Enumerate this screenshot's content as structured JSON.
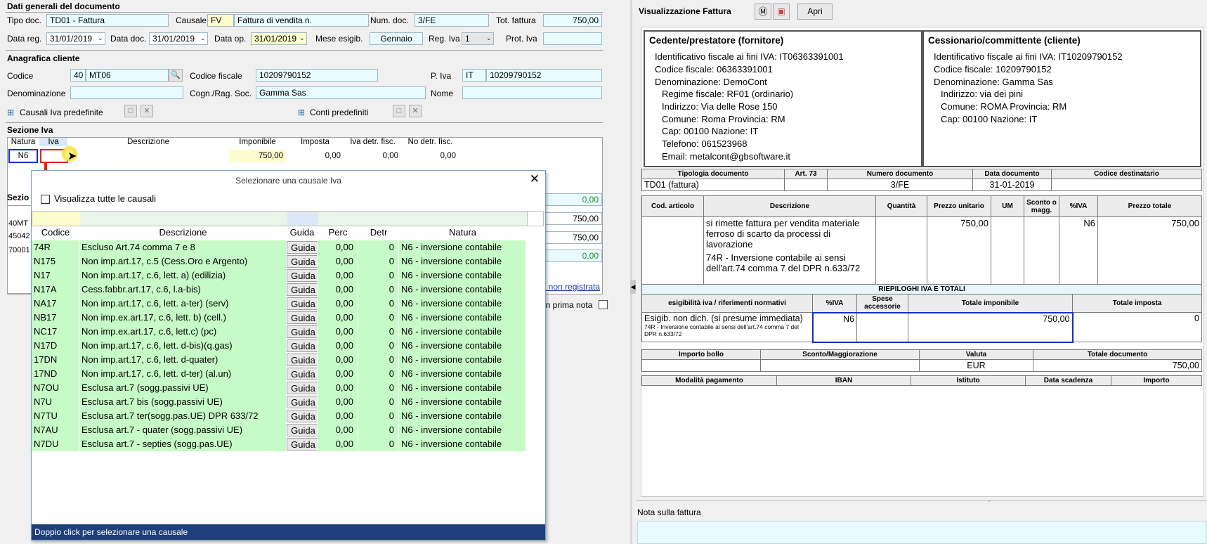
{
  "left": {
    "section_general": "Dati generali del documento",
    "tipo_doc_label": "Tipo doc.",
    "tipo_doc_value": "TD01 - Fattura",
    "causale_label": "Causale",
    "causale_code": "FV",
    "causale_desc": "Fattura di vendita n.",
    "num_doc_label": "Num. doc.",
    "num_doc_value": "3/FE",
    "tot_fattura_label": "Tot. fattura",
    "tot_fattura_value": "750,00",
    "data_reg_label": "Data reg.",
    "data_reg_value": "31/01/2019",
    "data_doc_label": "Data doc.",
    "data_doc_value": "31/01/2019",
    "data_op_label": "Data op.",
    "data_op_value": "31/01/2019",
    "mese_esigib_label": "Mese esigib.",
    "mese_esigib_value": "Gennaio",
    "reg_iva_label": "Reg. Iva",
    "reg_iva_value": "1",
    "prot_iva_label": "Prot. Iva",
    "prot_iva_value": "",
    "section_cliente": "Anagrafica cliente",
    "codice_label": "Codice",
    "codice_num": "40",
    "codice_value": "MT06",
    "codice_fiscale_label": "Codice fiscale",
    "codice_fiscale_value": "10209790152",
    "piva_label": "P. Iva",
    "piva_country": "IT",
    "piva_value": "10209790152",
    "denominazione_label": "Denominazione",
    "cogn_label": "Cogn./Rag. Soc.",
    "cogn_value": "Gamma Sas",
    "nome_label": "Nome",
    "causali_predef": "Causali Iva predefinite",
    "conti_predef": "Conti predefiniti",
    "section_iva": "Sezione Iva",
    "iva_cols": [
      "Natura",
      "Iva",
      "Descrizione",
      "Imponibile",
      "Imposta",
      "Iva detr. fisc.",
      "No detr. fisc."
    ],
    "iva_row": {
      "natura": "N6",
      "iva": "",
      "descrizione": "",
      "imponibile": "750,00",
      "imposta": "0,00",
      "detr": "0,00",
      "nodetr": "0,00"
    },
    "section_other_partial": "Sezio",
    "partial_rows": [
      "40MT",
      "45042",
      "70001"
    ],
    "right_vals": [
      "0,00",
      "750,00",
      "750,00",
      "0,00"
    ],
    "link_non_registrata": "t non registrata",
    "prima_nota": "in prima nota"
  },
  "popup": {
    "title": "Selezionare una causale Iva",
    "checkbox_label": "Visualizza tutte le causali",
    "columns": [
      "Codice",
      "Descrizione",
      "Guida",
      "Perc",
      "Detr",
      "Natura"
    ],
    "rows": [
      {
        "codice": "74R",
        "descrizione": "Escluso Art.74 comma 7 e 8",
        "guida": "Guida",
        "perc": "0,00",
        "detr": "0",
        "natura": "N6 - inversione contabile"
      },
      {
        "codice": "N175",
        "descrizione": "Non imp.art.17, c.5 (Cess.Oro e Argento)",
        "guida": "Guida",
        "perc": "0,00",
        "detr": "0",
        "natura": "N6 - inversione contabile"
      },
      {
        "codice": "N17",
        "descrizione": "Non imp.art.17, c.6, lett. a) (edilizia)",
        "guida": "Guida",
        "perc": "0,00",
        "detr": "0",
        "natura": "N6 - inversione contabile"
      },
      {
        "codice": "N17A",
        "descrizione": "Cess.fabbr.art.17, c.6, l.a-bis)",
        "guida": "Guida",
        "perc": "0,00",
        "detr": "0",
        "natura": "N6 - inversione contabile"
      },
      {
        "codice": "NA17",
        "descrizione": "Non imp.art.17, c.6, lett. a-ter) (serv)",
        "guida": "Guida",
        "perc": "0,00",
        "detr": "0",
        "natura": "N6 - inversione contabile"
      },
      {
        "codice": "NB17",
        "descrizione": "Non imp.ex.art.17, c.6, lett. b) (cell.)",
        "guida": "Guida",
        "perc": "0,00",
        "detr": "0",
        "natura": "N6 - inversione contabile"
      },
      {
        "codice": "NC17",
        "descrizione": "Non imp.ex.art.17, c.6, lett.c) (pc)",
        "guida": "Guida",
        "perc": "0,00",
        "detr": "0",
        "natura": "N6 - inversione contabile"
      },
      {
        "codice": "N17D",
        "descrizione": "Non imp.art.17, c.6, lett. d-bis)(q.gas)",
        "guida": "Guida",
        "perc": "0,00",
        "detr": "0",
        "natura": "N6 - inversione contabile"
      },
      {
        "codice": "17DN",
        "descrizione": "Non imp.art.17, c.6, lett. d-quater)",
        "guida": "Guida",
        "perc": "0,00",
        "detr": "0",
        "natura": "N6 - inversione contabile"
      },
      {
        "codice": "17ND",
        "descrizione": "Non imp.art.17, c.6, lett. d-ter) (al.un)",
        "guida": "Guida",
        "perc": "0,00",
        "detr": "0",
        "natura": "N6 - inversione contabile"
      },
      {
        "codice": "N7OU",
        "descrizione": "Esclusa art.7 (sogg.passivi UE)",
        "guida": "Guida",
        "perc": "0,00",
        "detr": "0",
        "natura": "N6 - inversione contabile"
      },
      {
        "codice": "N7U",
        "descrizione": "Esclusa art.7 bis (sogg.passivi UE)",
        "guida": "Guida",
        "perc": "0,00",
        "detr": "0",
        "natura": "N6 - inversione contabile"
      },
      {
        "codice": "N7TU",
        "descrizione": "Esclusa art.7 ter(sogg.pas.UE) DPR 633/72",
        "guida": "Guida",
        "perc": "0,00",
        "detr": "0",
        "natura": "N6 - inversione contabile"
      },
      {
        "codice": "N7AU",
        "descrizione": "Esclusa art.7 - quater (sogg.passivi UE)",
        "guida": "Guida",
        "perc": "0,00",
        "detr": "0",
        "natura": "N6 - inversione contabile"
      },
      {
        "codice": "N7DU",
        "descrizione": "Esclusa art.7 - septies (sogg.pas.UE)",
        "guida": "Guida",
        "perc": "0,00",
        "detr": "0",
        "natura": "N6 - inversione contabile"
      }
    ],
    "footer": "Doppio click per selezionare una causale"
  },
  "right": {
    "title": "Visualizzazione Fattura",
    "apri_label": "Apri",
    "cedente_title": "Cedente/prestatore (fornitore)",
    "cedente_lines": [
      "Identificativo fiscale ai fini IVA: IT06363391001",
      "Codice fiscale: 06363391001",
      "Denominazione: DemoCont"
    ],
    "cedente_sub": [
      "Regime fiscale: RF01 (ordinario)",
      "Indirizzo: Via delle Rose 150",
      "Comune: Roma Provincia: RM",
      "Cap: 00100 Nazione: IT",
      "Telefono: 061523968",
      "Email: metalcont@gbsoftware.it"
    ],
    "cessionario_title": "Cessionario/committente (cliente)",
    "cessionario_lines": [
      "Identificativo fiscale ai fini IVA: IT10209790152",
      "Codice fiscale: 10209790152",
      "Denominazione: Gamma Sas"
    ],
    "cessionario_sub": [
      "Indirizzo: via dei pini",
      "Comune: ROMA Provincia: RM",
      "Cap: 00100 Nazione: IT"
    ],
    "doc_headers": [
      "Tipologia documento",
      "Art. 73",
      "Numero documento",
      "Data documento",
      "Codice destinatario"
    ],
    "doc_values": [
      "TD01 (fattura)",
      "",
      "3/FE",
      "31-01-2019",
      ""
    ],
    "line_headers": [
      "Cod. articolo",
      "Descrizione",
      "Quantità",
      "Prezzo unitario",
      "UM",
      "Sconto o magg.",
      "%IVA",
      "Prezzo totale"
    ],
    "line_desc1": "si rimette fattura per vendita materiale ferroso di scarto da processi di lavorazione",
    "line_desc2": "74R - Inversione contabile ai sensi dell'art.74 comma 7 del DPR n.633/72",
    "line_prezzo_unit": "750,00",
    "line_iva": "N6",
    "line_totale": "750,00",
    "riepiloghi_title": "RIEPILOGHI IVA E TOTALI",
    "riep_headers": [
      "esigibilità iva / riferimenti normativi",
      "%IVA",
      "Spese accessorie",
      "Totale imponibile",
      "Totale imposta"
    ],
    "riep_esig": "Esigib. non dich. (si presume immediata)",
    "riep_note": "74R - Inversione contabile ai sensi dell'art.74 comma 7 del DPR n.633/72",
    "riep_iva": "N6",
    "riep_imponibile": "750,00",
    "riep_imposta": "0",
    "tot_headers": [
      "Importo bollo",
      "Sconto/Maggiorazione",
      "Valuta",
      "Totale documento"
    ],
    "tot_values": [
      "",
      "",
      "EUR",
      "750,00"
    ],
    "pag_headers": [
      "Modalità pagamento",
      "IBAN",
      "Istituto",
      "Data scadenza",
      "Importo"
    ],
    "nota_label": "Nota sulla fattura"
  }
}
